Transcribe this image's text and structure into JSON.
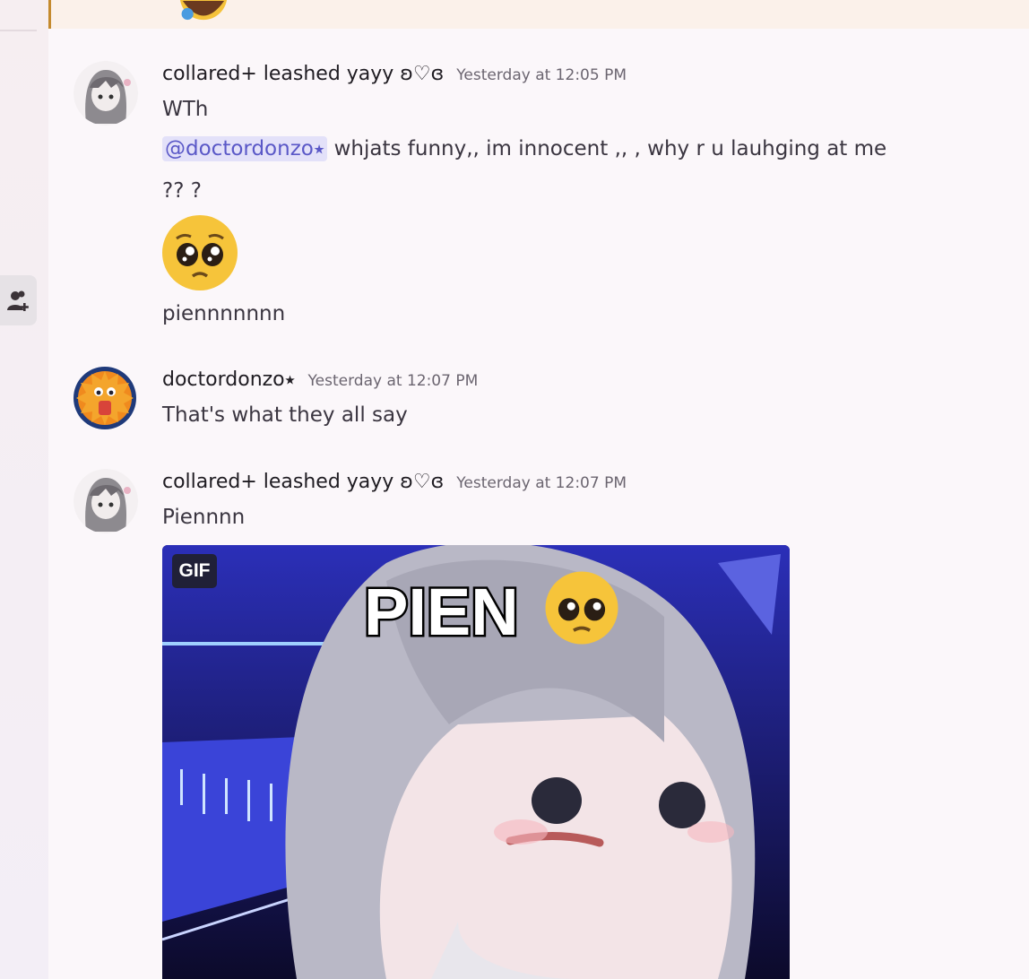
{
  "messages": [
    {
      "username": "collared+ leashed yayy ʚ♡ɞ",
      "timestamp": "Yesterday at 12:05 PM",
      "lines": [
        "WTh"
      ],
      "mention": "@doctordonzo⭑",
      "mention_text": " whjats funny,, im innocent ,, , why r u lauhging at me",
      "line3": "?? ?",
      "emoji": "pleading-face-emoji",
      "line4": "piennnnnnn"
    },
    {
      "username": "doctordonzo⭑",
      "timestamp": "Yesterday at 12:07 PM",
      "text": "That's what they all say"
    },
    {
      "username": "collared+ leashed yayy ʚ♡ɞ",
      "timestamp": "Yesterday at 12:07 PM",
      "text": "Piennnn",
      "gif_badge": "GIF",
      "gif_caption": "PIEN"
    }
  ],
  "icons": {
    "rail_button": "add-friend-icon",
    "prev_emoji": "crying-laughing-emoji"
  },
  "colors": {
    "mention_bg": "#e3e1f9",
    "mention_fg": "#5a58c7",
    "highlight_border": "#c48a2e"
  }
}
